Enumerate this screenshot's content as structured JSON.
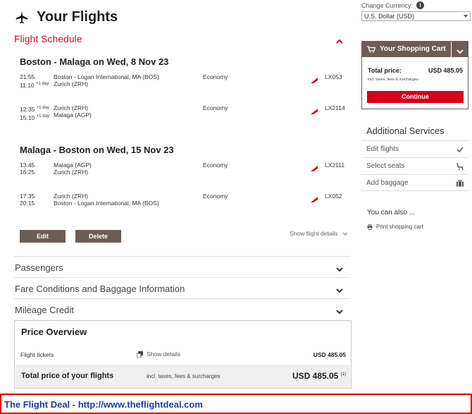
{
  "header": {
    "title": "Your Flights"
  },
  "schedule": {
    "title": "Flight Schedule",
    "routes": [
      {
        "title": "Boston - Malaga on Wed, 8 Nov 23",
        "segments": [
          {
            "dep_time": "21:55",
            "arr_time": "11:10",
            "arr_suffix": "+1 day",
            "dep_suffix": "",
            "from": "Boston - Logan International, MA (BOS)",
            "to": "Zurich (ZRH)",
            "cabin": "Economy",
            "flight": "LX053"
          },
          {
            "dep_time": "12:35",
            "arr_time": "15:10",
            "arr_suffix": "+1 day",
            "dep_suffix": "+1 day",
            "from": "Zurich (ZRH)",
            "to": "Malaga (AGP)",
            "cabin": "Economy",
            "flight": "LX2114"
          }
        ]
      },
      {
        "title": "Malaga - Boston on Wed, 15 Nov 23",
        "segments": [
          {
            "dep_time": "13:45",
            "arr_time": "16:25",
            "arr_suffix": "",
            "dep_suffix": "",
            "from": "Malaga (AGP)",
            "to": "Zurich (ZRH)",
            "cabin": "Economy",
            "flight": "LX2111"
          },
          {
            "dep_time": "17:35",
            "arr_time": "20:15",
            "arr_suffix": "",
            "dep_suffix": "",
            "from": "Zurich (ZRH)",
            "to": "Boston - Logan International, MA (BOS)",
            "cabin": "Economy",
            "flight": "LX052"
          }
        ]
      }
    ],
    "edit_label": "Edit",
    "delete_label": "Delete",
    "show_details_label": "Show flight details"
  },
  "accordions": [
    "Passengers",
    "Fare Conditions and Baggage Information",
    "Mileage Credit"
  ],
  "price": {
    "title": "Price Overview",
    "tickets_label": "Flight tickets",
    "show_details": "Show details",
    "tickets_value": "USD 485.05",
    "total_label": "Total price of your flights",
    "total_note": "incl. taxes, fees & surcharges",
    "total_value": "USD 485.05",
    "total_footnote": "(1)"
  },
  "currency": {
    "label": "Change Currency:",
    "info_glyph": "i",
    "selected": "U.S. Dollar (USD)"
  },
  "cart": {
    "title": "Your Shopping Cart",
    "total_label": "Total price:",
    "total_value": "USD 485.05",
    "note": "incl. taxes, fees & surcharges",
    "continue_label": "Continue"
  },
  "services": {
    "title": "Additional Services",
    "items": [
      "Edit flights",
      "Select seats",
      "Add baggage"
    ]
  },
  "also": {
    "title": "You can also ...",
    "print": "Print shopping cart"
  },
  "banner": {
    "text": "The Flight Deal - http://www.theflightdeal.com"
  },
  "colors": {
    "accent_red": "#c8102e",
    "button_brown": "#6b5d57",
    "banner_blue": "#1a3fa0"
  }
}
